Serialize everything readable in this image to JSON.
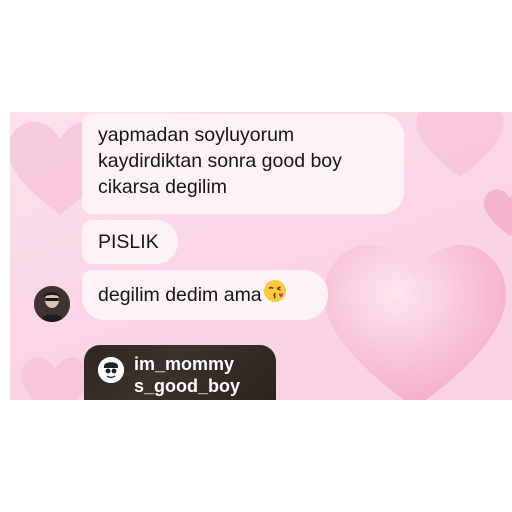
{
  "messages": [
    {
      "lines": [
        "yapmadan soyluyorum",
        "kaydirdiktan sonra good boy",
        "cikarsa degilim"
      ]
    },
    {
      "lines": [
        "PISLIK"
      ]
    },
    {
      "lines": [
        "degilim dedim ama"
      ],
      "emoji": "face-blowing-kiss-emoji"
    }
  ],
  "shared_profile": {
    "username_lines": [
      "im_mommy",
      "s_good_boy"
    ],
    "avatar_icon": "cartoon-face-icon"
  },
  "sender_avatar_icon": "avatar",
  "colors": {
    "background": "#fbd6e6",
    "bubble": "#fdf2f6",
    "text": "#161616",
    "card": "#2e2620"
  }
}
